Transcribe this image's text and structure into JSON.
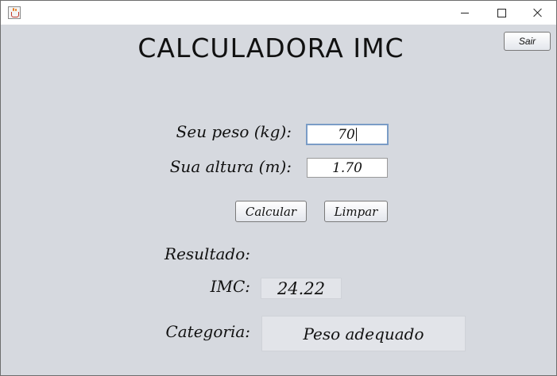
{
  "window": {
    "title_bar_icon": "java-coffee-cup-icon"
  },
  "window_controls": {
    "minimize_icon": "minimize-icon",
    "maximize_icon": "maximize-icon",
    "close_icon": "close-icon"
  },
  "app": {
    "title": "CALCULADORA IMC",
    "exit_label": "Sair"
  },
  "form": {
    "weight_label": "Seu peso (kg):",
    "weight_value": "70",
    "height_label": "Sua altura (m):",
    "height_value": "1.70",
    "calculate_label": "Calcular",
    "clear_label": "Limpar"
  },
  "result": {
    "heading": "Resultado:",
    "imc_label": "IMC:",
    "imc_value": "24.22",
    "category_label": "Categoria:",
    "category_value": "Peso adequado"
  },
  "colors": {
    "background": "#d6d9df",
    "output_box": "#e2e4e9",
    "focus_border": "#7a9cc6"
  }
}
